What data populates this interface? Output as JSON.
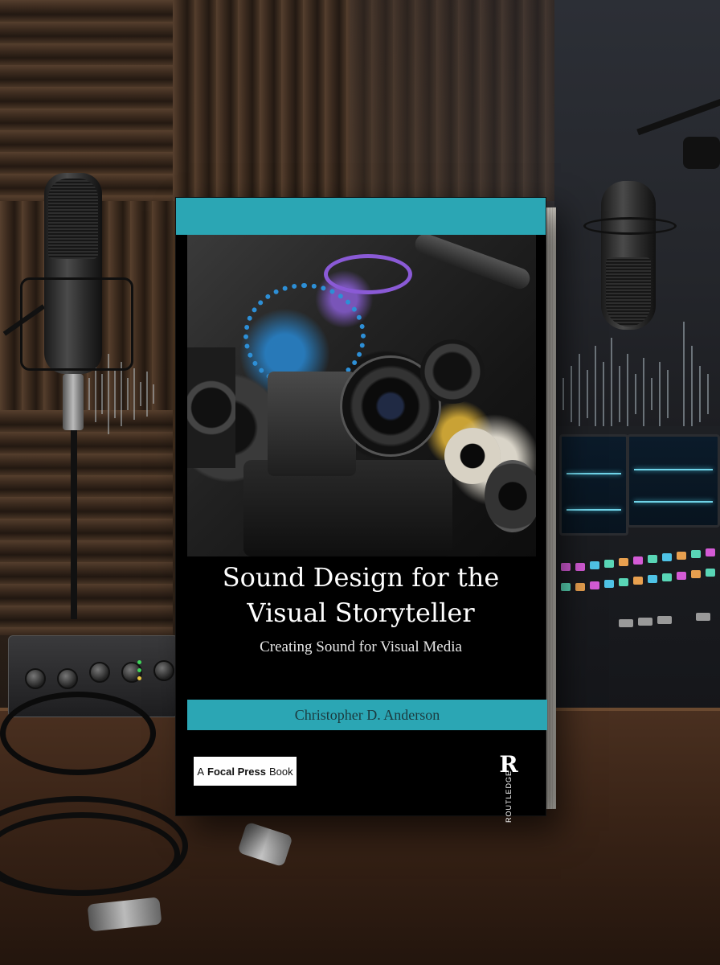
{
  "book": {
    "title_line1": "Sound Design for the",
    "title_line2": "Visual Storyteller",
    "subtitle": "Creating Sound for Visual Media",
    "author": "Christopher D. Anderson",
    "publisher_prefix": "A",
    "publisher_name": "Focal Press",
    "publisher_suffix": "Book",
    "imprint": "ROUTLEDGE",
    "imprint_logo": "R",
    "colors": {
      "accent_teal": "#2ba6b4",
      "cover_black": "#000000",
      "title_white": "#ffffff"
    }
  },
  "scene": {
    "icons": [
      "condenser-microphone-icon",
      "audio-interface-icon",
      "mixing-console-icon",
      "xlr-cable-icon"
    ]
  }
}
